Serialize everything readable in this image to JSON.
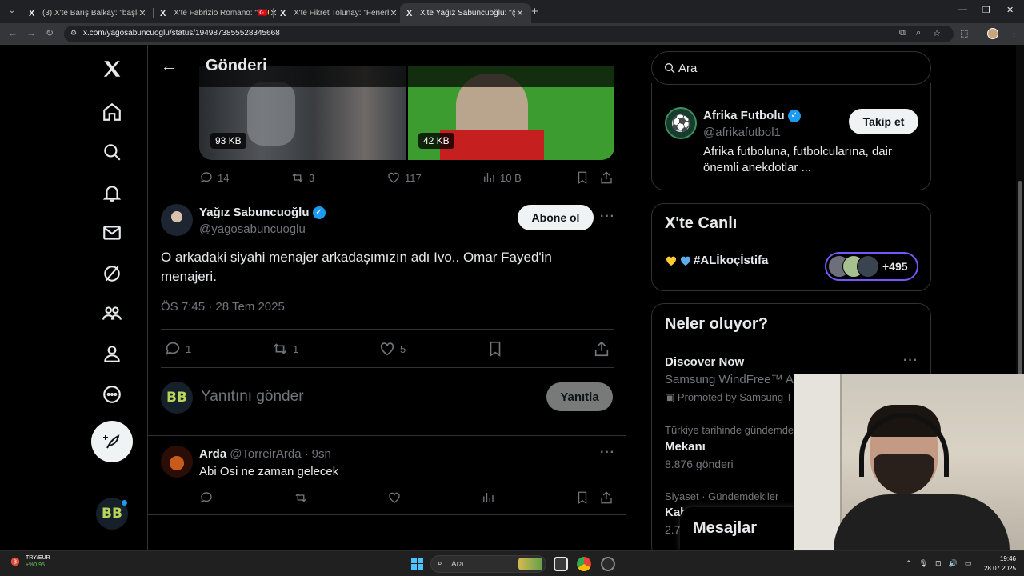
{
  "browser": {
    "tabs": [
      {
        "title": "(3) X'te Barış Balkay: \"başladık o",
        "active": false
      },
      {
        "title": "X'te Fabrizio Romano: \"🇹🇷🟡🔵",
        "active": false
      },
      {
        "title": "X'te Fikret Tolunay: \"Fenerbahçe",
        "active": false
      },
      {
        "title": "X'te Yağız Sabuncuoğlu: \"@afri",
        "active": true
      }
    ],
    "url": "x.com/yagosabuncuoglu/status/1949873855528345668",
    "tab_favicon": "X"
  },
  "header": {
    "title": "Gönderi"
  },
  "media": {
    "left_size": "93 KB",
    "right_size": "42 KB"
  },
  "prev_tweet_stats": {
    "replies": "14",
    "reposts": "3",
    "likes": "117",
    "views": "10 B"
  },
  "tweet": {
    "author_name": "Yağız Sabuncuoğlu",
    "author_handle": "@yagosabuncuoglu",
    "subscribe_label": "Abone ol",
    "text": "O arkadaki siyahi menajer arkadaşımızın adı Ivo.. Omar Fayed'in menajeri.",
    "timestamp": "ÖS 7:45 · 28 Tem 2025",
    "replies": "1",
    "reposts": "1",
    "likes": "5"
  },
  "composer": {
    "placeholder": "Yanıtını gönder",
    "reply_label": "Yanıtla",
    "avatar_text": "BB"
  },
  "reply": {
    "author_name": "Arda",
    "author_handle": "@TorreirArda",
    "time": "9sn",
    "text": "Abi Osi ne zaman gelecek"
  },
  "sidebar": {
    "search_placeholder": "Ara",
    "follow_suggestion": {
      "name": "Afrika Futbolu",
      "handle": "@afrikafutbol1",
      "bio": "Afrika futboluna, futbolcularına, dair önemli anekdotlar ...",
      "button": "Takip et"
    },
    "live": {
      "title": "X'te Canlı",
      "tag": "#ALİkoçİstifa",
      "count": "+495"
    },
    "trends": {
      "title": "Neler oluyor?",
      "items": [
        {
          "name": "Discover Now",
          "sub": "Samsung WindFree™ A",
          "ctx": "Promoted by Samsung T"
        },
        {
          "ctx": "Türkiye tarihinde gündemde",
          "name": "Mekanı",
          "sub": "8.876 gönderi"
        },
        {
          "ctx": "Siyaset · Gündemdekiler",
          "name": "Kab",
          "sub": "2.7"
        }
      ]
    }
  },
  "messages_drawer": {
    "label": "Mesajlar"
  },
  "taskbar": {
    "currency": "TRY/EUR",
    "currency_change": "+%0,95",
    "search_placeholder": "Ara",
    "time": "19:46",
    "date": "28.07.2025"
  },
  "colors": {
    "accent": "#1d9bf0",
    "background": "#000000",
    "border": "#2f3336",
    "muted": "#71767b",
    "live_ring": "#7856ff"
  }
}
